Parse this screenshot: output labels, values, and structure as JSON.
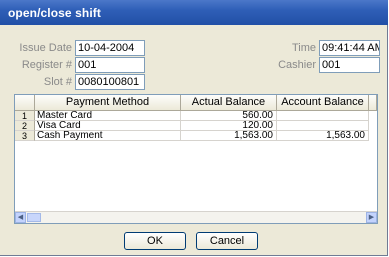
{
  "window": {
    "title": "open/close shift"
  },
  "form": {
    "issue_date_label": "Issue Date",
    "issue_date_value": "10-04-2004",
    "register_label": "Register #",
    "register_value": "001",
    "slot_label": "Slot #",
    "slot_value": "0080100801",
    "time_label": "Time",
    "time_value": "09:41:44 AM",
    "cashier_label": "Cashier",
    "cashier_value": "001"
  },
  "grid": {
    "columns": [
      "Payment Method",
      "Actual Balance",
      "Account Balance"
    ],
    "rows": [
      {
        "num": "1",
        "method": "Master Card",
        "actual": "560.00",
        "account": ""
      },
      {
        "num": "2",
        "method": "Visa Card",
        "actual": "120.00",
        "account": ""
      },
      {
        "num": "3",
        "method": "Cash Payment",
        "actual": "1,563.00",
        "account": "1,563.00"
      }
    ]
  },
  "buttons": {
    "ok_label": "OK",
    "cancel_label": "Cancel"
  }
}
